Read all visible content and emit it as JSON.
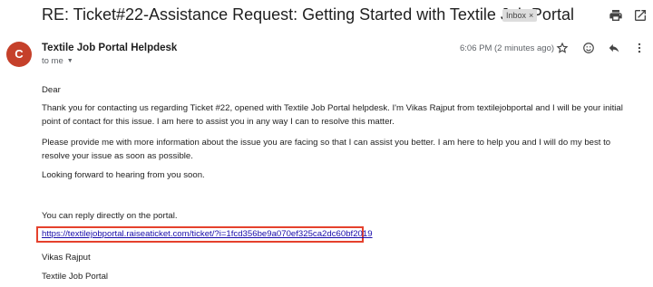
{
  "email": {
    "subject": "RE: Ticket#22-Assistance Request: Getting Started with Textile Job Portal",
    "label_chip": "Inbox",
    "label_chip_remove": "×",
    "sender_initial": "C",
    "sender_name": "Textile Job Portal Helpdesk",
    "recipient": "to me",
    "timestamp": "6:06 PM (2 minutes ago)",
    "avatar_color": "#c5402a"
  },
  "body": {
    "greeting": "Dear",
    "paragraph1": "Thank you for contacting us regarding Ticket #22, opened with Textile Job Portal helpdesk. I'm Vikas Rajput from textilejobportal and I will be your initial point of contact for this issue. I am here to assist you in any way I can to resolve this matter.",
    "paragraph2": "Please provide me with more information about the issue you are facing so that I can assist you better. I am here to help you and I will do my best to resolve your issue as soon as possible.",
    "paragraph3": "Looking forward to hearing from you soon.",
    "reply_note": "You can reply directly on the portal.",
    "portal_link": "https://textilejobportal.raiseaticket.com/ticket/?i=1fcd356be9a070ef325ca2dc60bf2019",
    "signature_name": "Vikas Rajput",
    "signature_org": "Textile Job Portal"
  },
  "icons": {
    "print": "print-icon",
    "open_new_window": "open-in-new-window-icon",
    "star": "star-icon",
    "emoji": "emoji-reaction-icon",
    "reply": "reply-icon",
    "recipient_dropdown": "chevron-down-icon"
  },
  "colors": {
    "highlight_box": "#e5412d",
    "link": "#1a0dab"
  }
}
